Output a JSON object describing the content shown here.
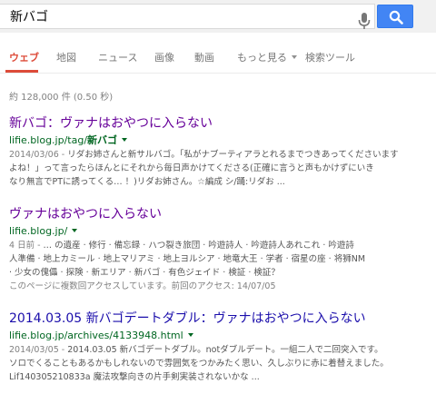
{
  "search": {
    "query": "新バゴ"
  },
  "tabs": [
    {
      "label": "ウェブ"
    },
    {
      "label": "地図"
    },
    {
      "label": "ニュース"
    },
    {
      "label": "画像"
    },
    {
      "label": "動画"
    },
    {
      "label": "もっと見る"
    },
    {
      "label": "検索ツール"
    }
  ],
  "stats": {
    "text": "約 128,000 件 (0.50 秒)"
  },
  "results": [
    {
      "title": "新バゴ：ヴァナはおやつに入らない",
      "url_pre": "lifie.blog.jp/tag/",
      "url_bold": "新バゴ",
      "snippet_lines": [
        {
          "date": "2014/03/06 - ",
          "text": "リダお姉さんと新サルバゴ。「私がナブーティアラとれるまでつきあってくださいます"
        },
        {
          "date": "",
          "text": "よね！」って言ったらほんとにそれから毎日声かけてくださる(正確に言うと声もかけずにいき"
        },
        {
          "date": "",
          "text": "なり無言でPTに誘ってくる… ！)リダお姉さん。☆編成 シ/踊:リダお ..."
        }
      ]
    },
    {
      "title": "ヴァナはおやつに入らない",
      "url_pre": "lifie.blog.jp/",
      "url_bold": "",
      "snippet_lines": [
        {
          "date": "4 日前 - ",
          "text": "… の遺産 · 修行 · 備忘録 · ハつ裂き旅団 · 吟遊詩人 · 吟遊詩人あれこれ · 吟遊詩"
        },
        {
          "date": "",
          "text": "人準備 · 地上カミール · 地上マリアミ · 地上ヨルシア · 地竜大王 · 学者 · 宿星の座 · 将狮NM"
        },
        {
          "date": "",
          "text": "· 少女の傀儡 · 探険 · 新エリア · 新バゴ · 有色ジェイド · 検証 · 検証？"
        },
        {
          "visit": "このページに複数回アクセスしています。前回のアクセス: 14/07/05"
        }
      ]
    },
    {
      "title": "2014.03.05 新バゴデートダブル：ヴァナはおやつに入らない",
      "url_pre": "lifie.blog.jp/archives/4133948.html",
      "url_bold": "",
      "snippet_lines": [
        {
          "date": "2014/03/05 - ",
          "text": "2014.03.05 新バゴデートダブル。notダブルデート。一組二人で二回突入です。"
        },
        {
          "date": "",
          "text": "ソロでくることもあるかもしれないので雰囲気をつかみたく思い、久しぶりに赤に着替えました。"
        },
        {
          "date": "",
          "text": "Lif140305210833a 魔法攻撃向きの片手剣実装されないかな ..."
        }
      ]
    }
  ]
}
